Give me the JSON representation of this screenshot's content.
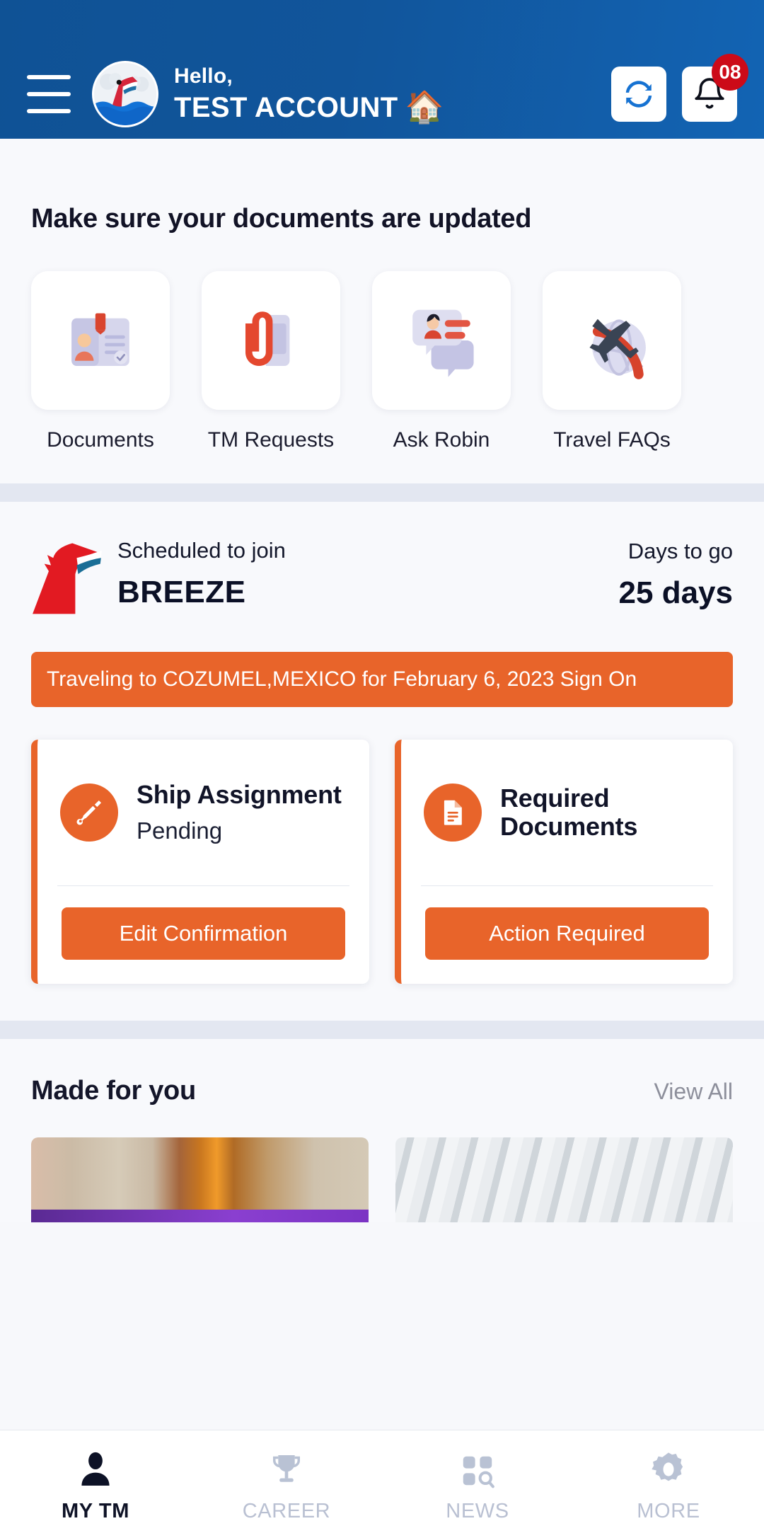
{
  "header": {
    "menu_icon": "hamburger-menu-icon",
    "avatar_icon": "carnival-funnel-avatar",
    "greeting": "Hello,",
    "account_name": "TEST ACCOUNT",
    "home_emoji": "🏠",
    "refresh_icon": "refresh-icon",
    "notification_icon": "bell-icon",
    "notification_count": "08",
    "bg_color": "#11559b",
    "badge_color": "#cc0a18"
  },
  "documents_section": {
    "title": "Make sure your documents are updated",
    "tiles": [
      {
        "label": "Documents",
        "icon": "id-card-icon"
      },
      {
        "label": "TM Requests",
        "icon": "paperclip-document-icon"
      },
      {
        "label": "Ask Robin",
        "icon": "chat-bubbles-icon"
      },
      {
        "label": "Travel FAQs",
        "icon": "airplane-globe-icon"
      }
    ]
  },
  "ship_section": {
    "ship_logo_icon": "carnival-funnel-logo",
    "scheduled_label": "Scheduled to join",
    "ship_name": "BREEZE",
    "days_label": "Days to go",
    "days_value": "25 days",
    "travel_banner": "Traveling to COZUMEL,MEXICO for February 6, 2023 Sign On",
    "accent_color": "#e8642a",
    "cards": [
      {
        "icon": "pen-nib-icon",
        "title": "Ship Assignment",
        "status": "Pending",
        "button": "Edit Confirmation"
      },
      {
        "icon": "document-icon",
        "title": "Required Documents",
        "status": "",
        "button": "Action Required"
      }
    ]
  },
  "made_for_you": {
    "title": "Made for you",
    "view_all": "View All",
    "cards": [
      {
        "image": "ship-interior-photo"
      },
      {
        "image": "architecture-photo"
      }
    ]
  },
  "bottom_nav": {
    "items": [
      {
        "label": "MY TM",
        "icon": "person-icon",
        "active": true
      },
      {
        "label": "CAREER",
        "icon": "trophy-icon",
        "active": false
      },
      {
        "label": "NEWS",
        "icon": "grid-search-icon",
        "active": false
      },
      {
        "label": "MORE",
        "icon": "gear-icon",
        "active": false
      }
    ]
  }
}
